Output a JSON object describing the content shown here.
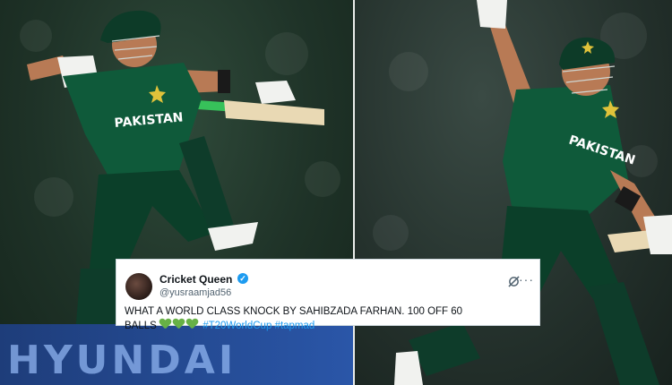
{
  "left_photo": {
    "jersey_text": "PAKISTAN",
    "ad_text": "HYUNDAI"
  },
  "right_photo": {
    "jersey_text": "PAKISTAN"
  },
  "tweet": {
    "display_name": "Cricket Queen",
    "handle": "@yusraamjad56",
    "verified": true,
    "text_line1": "WHAT A WORLD CLASS KNOCK BY SAHIBZADA FARHAN. 100 OFF 60",
    "text_line2": "BALLS",
    "emoji": "green-heart-icon",
    "emoji_count": 3,
    "hashtags": "#T20WorldCup #tapmad"
  },
  "colors": {
    "jersey": "#0f5a3a",
    "verified": "#1d9bf0",
    "hashtag": "#1d9bf0",
    "heart": "#67b146",
    "ad_board": "#2a56a8"
  }
}
